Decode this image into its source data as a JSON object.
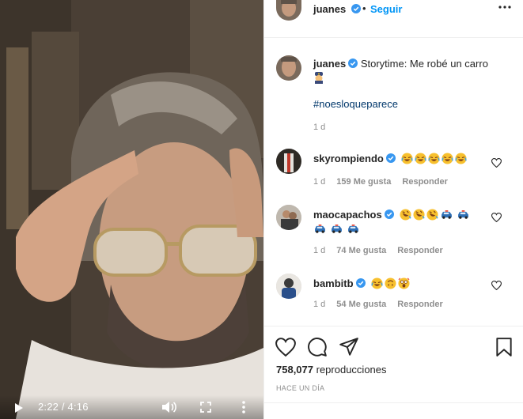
{
  "video": {
    "time_display": "2:22 / 4:16"
  },
  "post": {
    "username": "juanes",
    "follow_label": "Seguir",
    "caption": "Storytime: Me robé un carro",
    "hashtag": "#noesloqueparece",
    "caption_age": "1 d"
  },
  "comments": [
    {
      "username": "skyrompiendo",
      "age": "1 d",
      "likes": "159 Me gusta",
      "reply": "Responder"
    },
    {
      "username": "maocapachos",
      "age": "1 d",
      "likes": "74 Me gusta",
      "reply": "Responder"
    },
    {
      "username": "bambitb",
      "age": "1 d",
      "likes": "54 Me gusta",
      "reply": "Responder"
    }
  ],
  "footer": {
    "views_count": "758,077",
    "views_label": "reproducciones",
    "posted_ago": "HACE UN DÍA"
  },
  "colors": {
    "link_blue": "#0095f6",
    "hashtag_blue": "#00376b",
    "muted_gray": "#8e8e8e",
    "verified_blue": "#3897f0"
  }
}
